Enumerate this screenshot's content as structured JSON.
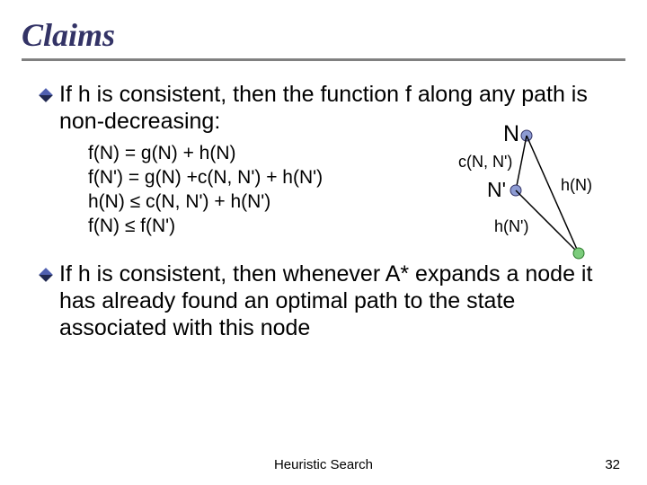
{
  "title": "Claims",
  "bullet1": "If h is consistent, then the function f along any path is non-decreasing:",
  "equations": {
    "l1": "f(N) = g(N) + h(N)",
    "l2": "f(N') = g(N) +c(N, N') + h(N')",
    "l3": "h(N) ≤ c(N, N') + h(N')",
    "l4": "f(N) ≤ f(N')"
  },
  "diagram": {
    "nodeN": "N",
    "nodeNp": "N'",
    "edgeTop": "c(N, N')",
    "edgeRight": "h(N)",
    "edgeBottom": "h(N')"
  },
  "bullet2": "If h is consistent, then whenever A* expands a node it has already found an optimal path to the state associated with this node",
  "footer": {
    "center": "Heuristic Search",
    "page": "32"
  }
}
